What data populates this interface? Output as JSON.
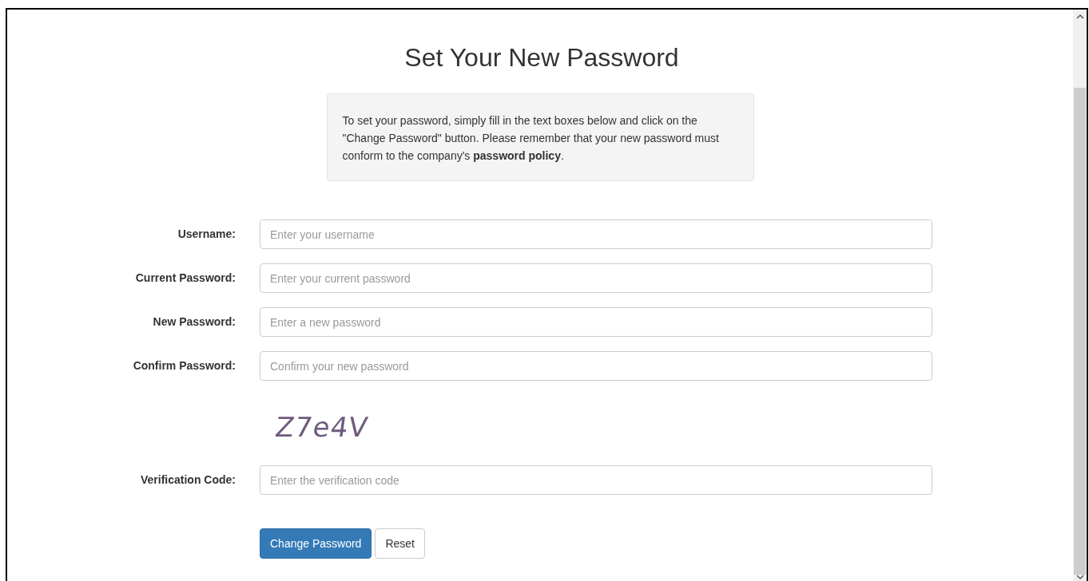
{
  "title": "Set Your New Password",
  "notice": "To set your password, simply fill in the text boxes below and click on the \"Change Password\" button. Please remember that your new password must conform to the company's **password policy**.",
  "fields": [
    {
      "label": "Username:",
      "placeholder": "Enter your username"
    },
    {
      "label": "Current Password:",
      "placeholder": "Enter your current password"
    },
    {
      "label": "New Password:",
      "placeholder": "Enter a new password"
    },
    {
      "label": "Confirm Password:",
      "placeholder": "Confirm your new password"
    }
  ],
  "captcha": {
    "code": "Z7e4V",
    "label": "Verification Code:",
    "placeholder": "Enter the verification code"
  },
  "buttons": [
    {
      "label": "Change Password",
      "kind": "primary"
    },
    {
      "label": "Reset",
      "kind": "default"
    }
  ]
}
